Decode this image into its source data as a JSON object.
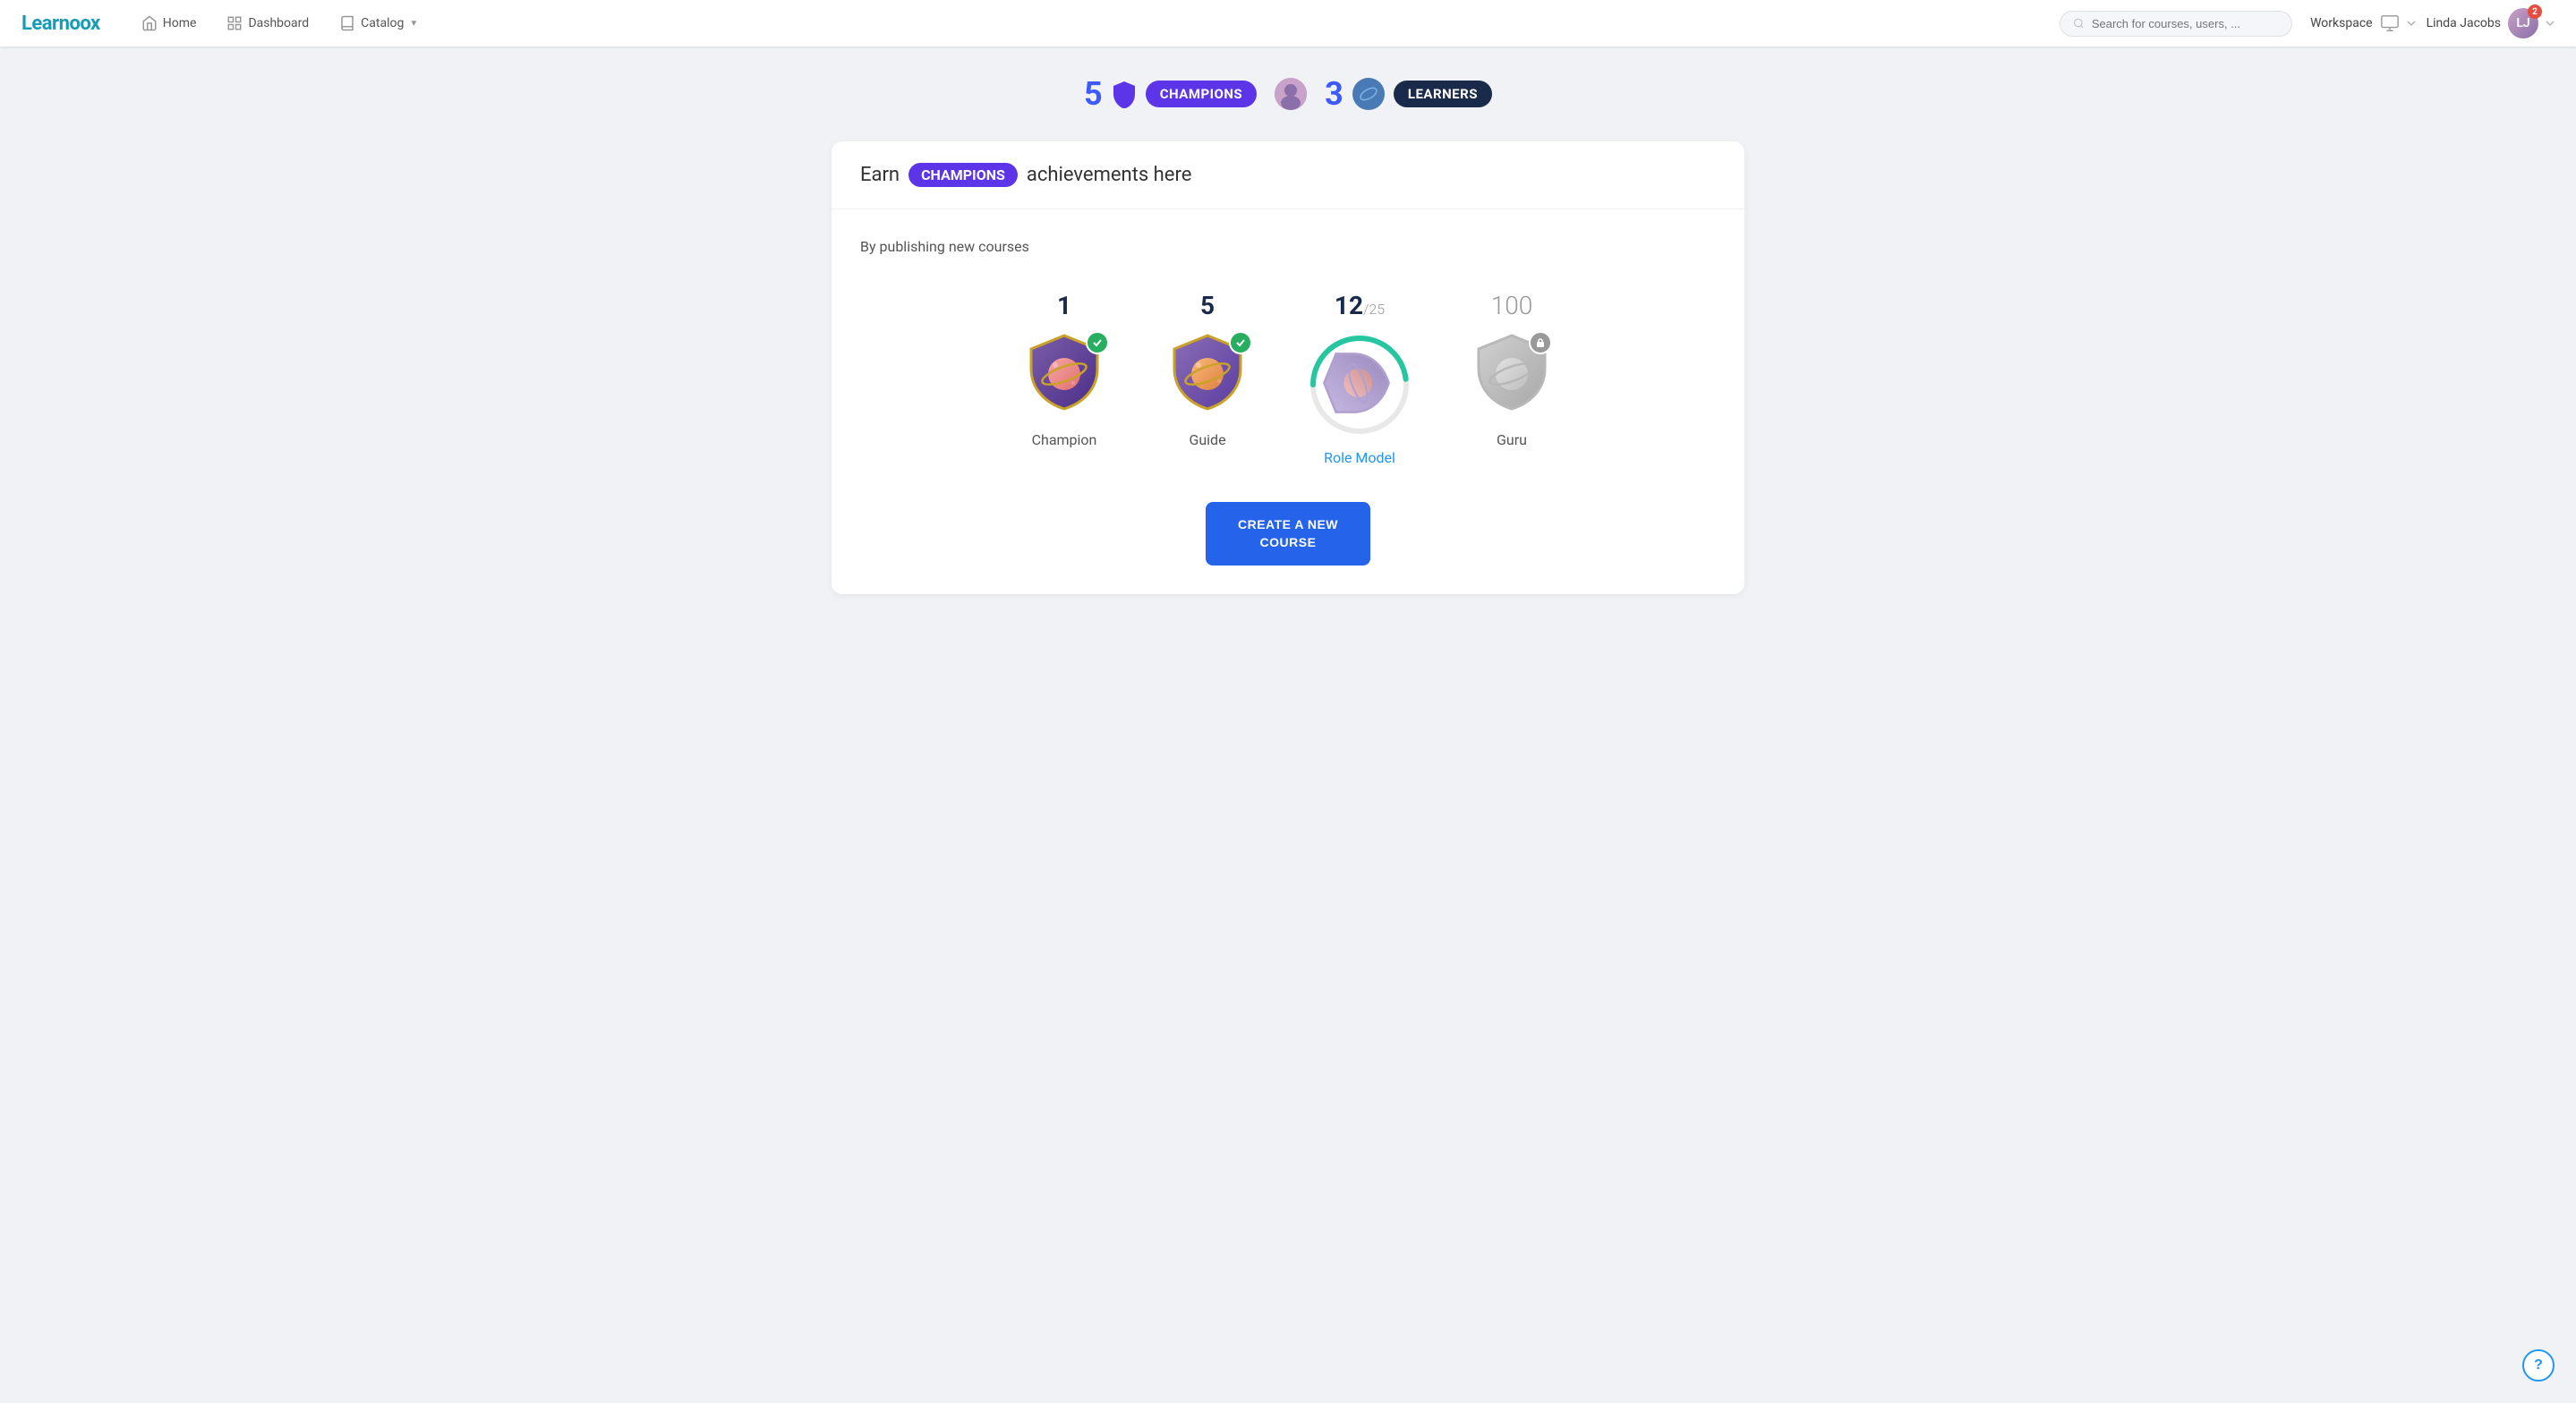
{
  "logo": {
    "text": "Learnoox"
  },
  "nav": {
    "home_label": "Home",
    "dashboard_label": "Dashboard",
    "catalog_label": "Catalog",
    "search_placeholder": "Search for courses, users, ..."
  },
  "nav_right": {
    "workspace_label": "Workspace",
    "user_name": "Linda Jacobs",
    "notification_count": "2"
  },
  "stats": {
    "champions_count": "5",
    "champions_label": "CHAMPIONS",
    "learners_count": "3",
    "learners_label": "LEARNERS"
  },
  "header": {
    "earn_text": "Earn",
    "champions_badge": "CHAMPIONS",
    "achievements_text": "achievements here"
  },
  "section": {
    "title": "By publishing new courses"
  },
  "badges": [
    {
      "count": "1",
      "label": "Champion",
      "state": "completed",
      "count_display": "1"
    },
    {
      "count": "5",
      "label": "Guide",
      "state": "completed",
      "count_display": "5"
    },
    {
      "count": "12",
      "count_sub": "/25",
      "label": "Role Model",
      "state": "active",
      "progress": 48
    },
    {
      "count": "100",
      "label": "Guru",
      "state": "locked",
      "count_display": "100"
    }
  ],
  "cta": {
    "button_label": "CREATE A NEW\nCOURSE"
  },
  "help": {
    "label": "?"
  }
}
